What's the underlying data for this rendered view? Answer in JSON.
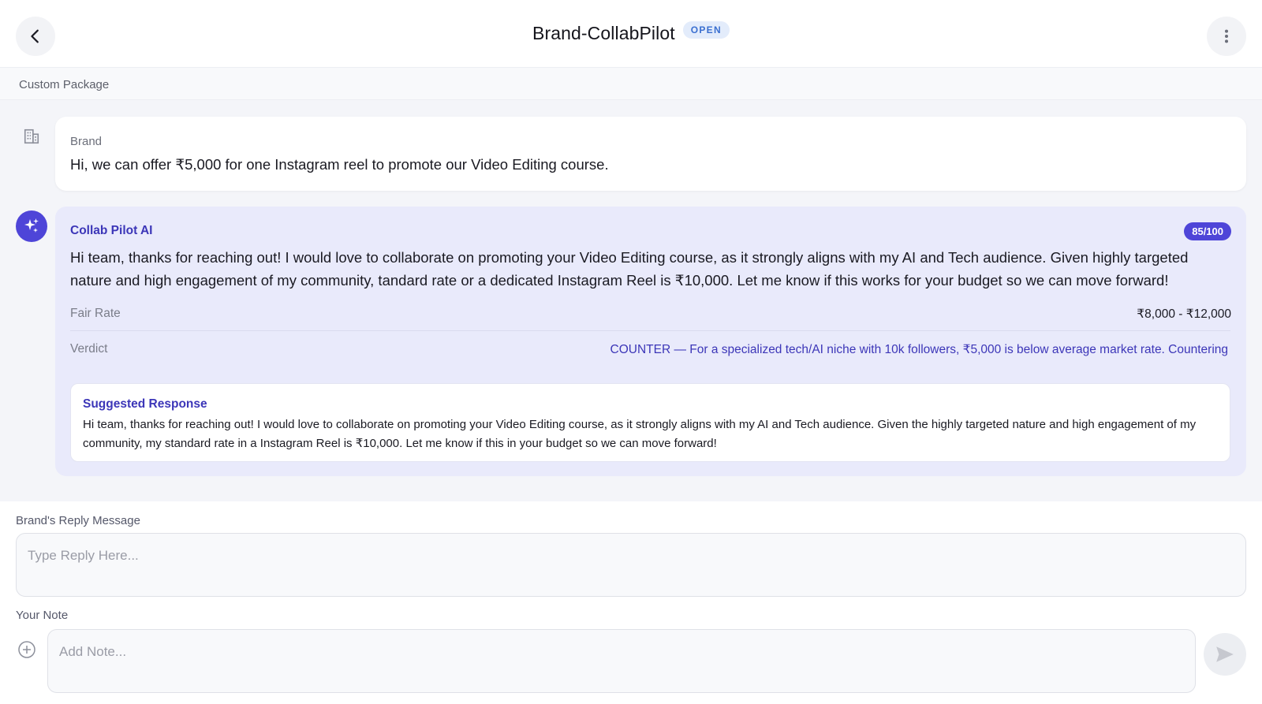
{
  "header": {
    "title": "Brand-CollabPilot",
    "status": "OPEN",
    "back_icon": "chevron-left-icon",
    "more_icon": "more-vertical-icon"
  },
  "subheader": {
    "label": "Custom Package"
  },
  "messages": {
    "brand": {
      "sender": "Brand",
      "icon": "building-icon",
      "text": "Hi, we can offer ₹5,000 for one Instagram reel to promote our Video Editing course."
    },
    "ai": {
      "sender": "Collab Pilot AI",
      "icon": "sparkles-icon",
      "score": "85/100",
      "text": "Hi team, thanks for reaching out! I would love to collaborate on promoting your Video Editing course, as it strongly aligns with my AI and Tech audience. Given highly targeted nature and high engagement of my community, tandard rate or a dedicated Instagram Reel is ₹10,000. Let me know if this works for your budget so we can move forward!",
      "fair_rate_label": "Fair Rate",
      "fair_rate_value": "₹8,000 - ₹12,000",
      "verdict_label": "Verdict",
      "verdict_value": "COUNTER — For a specialized tech/AI niche with 10k followers, ₹5,000 is below average market rate. Countering",
      "suggested": {
        "title": "Suggested Response",
        "text": "Hi team, thanks for reaching out! I would love to collaborate on promoting your Video Editing course, as it strongly aligns with my AI and Tech audience. Given the highly targeted nature and high engagement of my community, my standard rate in a Instagram Reel is ₹10,000. Let me know if this in your budget so we can move forward!"
      }
    }
  },
  "composer": {
    "reply_label": "Brand's Reply Message",
    "reply_value": "",
    "reply_placeholder": "Type Reply Here...",
    "note_label": "Your Note",
    "note_value": "",
    "note_placeholder": "Add Note...",
    "add_icon": "plus-circle-icon",
    "send_icon": "send-icon"
  },
  "colors": {
    "accent": "#4e45d8",
    "accent_text": "#3c36b8",
    "status_badge_bg": "#e3ecfb",
    "status_badge_text": "#3a6fd0",
    "ai_card_bg": "#e9eafb"
  }
}
